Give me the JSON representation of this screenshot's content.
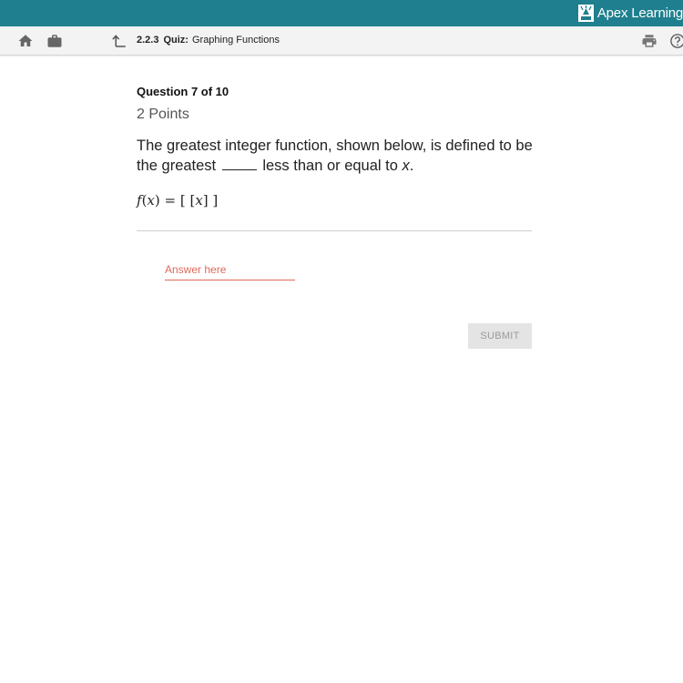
{
  "app": {
    "brand_name": "Apex Learning"
  },
  "toolbar": {
    "breadcrumb_number": "2.2.3",
    "breadcrumb_type": "Quiz:",
    "breadcrumb_title": "Graphing Functions",
    "icons": [
      "home-icon",
      "briefcase-icon",
      "back-arrow-icon",
      "print-icon",
      "help-icon"
    ]
  },
  "question": {
    "counter": "Question 7 of 10",
    "points": "2 Points",
    "prompt_part1": "The greatest integer function, shown below, is defined to be the greatest",
    "prompt_part2": "less than or equal to",
    "prompt_var": "x",
    "prompt_end": ".",
    "formula_f": "f",
    "formula_lparen": "(",
    "formula_x": "x",
    "formula_rest_a": ") = [ [",
    "formula_x2": "x",
    "formula_rest_b": "] ]"
  },
  "answer": {
    "placeholder": "Answer here",
    "value": ""
  },
  "submit": {
    "label": "SUBMIT"
  },
  "colors": {
    "topbar": "#1f7f8e",
    "accent_red": "#e06a5a",
    "submit_bg": "#e4e4e4"
  }
}
